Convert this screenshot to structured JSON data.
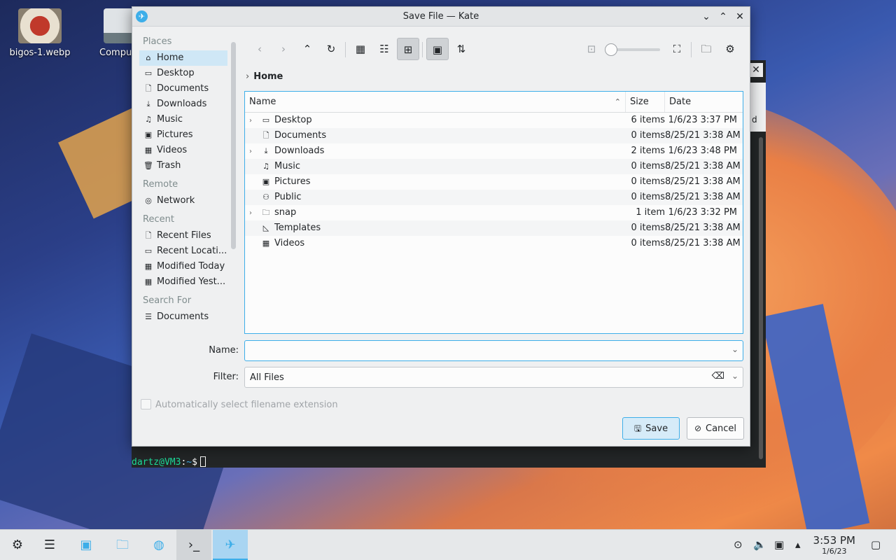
{
  "desktop": {
    "icons": [
      {
        "label": "bigos-1.webp"
      },
      {
        "label": "Compu"
      }
    ]
  },
  "terminal": {
    "prompt_user": "dartz@VM3",
    "prompt_sep": ":",
    "prompt_path": "~",
    "prompt_symbol": "$",
    "side_fragment": "d"
  },
  "dialog": {
    "title": "Save File — Kate",
    "places": {
      "sections": [
        {
          "header": "Places",
          "items": [
            "Home",
            "Desktop",
            "Documents",
            "Downloads",
            "Music",
            "Pictures",
            "Videos",
            "Trash"
          ]
        },
        {
          "header": "Remote",
          "items": [
            "Network"
          ]
        },
        {
          "header": "Recent",
          "items": [
            "Recent Files",
            "Recent Locati...",
            "Modified Today",
            "Modified Yest..."
          ]
        },
        {
          "header": "Search For",
          "items": [
            "Documents"
          ]
        }
      ]
    },
    "breadcrumb": "Home",
    "columns": {
      "name": "Name",
      "size": "Size",
      "date": "Date"
    },
    "files": [
      {
        "name": "Desktop",
        "size": "6 items",
        "date": "1/6/23 3:37 PM"
      },
      {
        "name": "Documents",
        "size": "0 items",
        "date": "8/25/21 3:38 AM"
      },
      {
        "name": "Downloads",
        "size": "2 items",
        "date": "1/6/23 3:48 PM"
      },
      {
        "name": "Music",
        "size": "0 items",
        "date": "8/25/21 3:38 AM"
      },
      {
        "name": "Pictures",
        "size": "0 items",
        "date": "8/25/21 3:38 AM"
      },
      {
        "name": "Public",
        "size": "0 items",
        "date": "8/25/21 3:38 AM"
      },
      {
        "name": "snap",
        "size": "1 item",
        "date": "1/6/23 3:32 PM"
      },
      {
        "name": "Templates",
        "size": "0 items",
        "date": "8/25/21 3:38 AM"
      },
      {
        "name": "Videos",
        "size": "0 items",
        "date": "8/25/21 3:38 AM"
      }
    ],
    "name_label": "Name:",
    "name_value": "",
    "filter_label": "Filter:",
    "filter_value": "All Files",
    "auto_ext_label": "Automatically select filename extension",
    "save_label": "Save",
    "cancel_label": "Cancel"
  },
  "taskbar": {
    "time": "3:53 PM",
    "date": "1/6/23"
  }
}
